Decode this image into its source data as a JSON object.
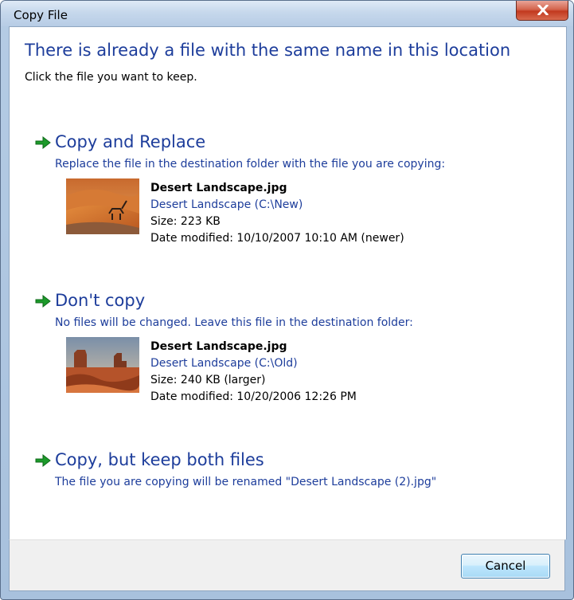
{
  "window": {
    "title": "Copy File"
  },
  "heading": "There is already a file with the same name in this location",
  "instruction": "Click the file you want to keep.",
  "options": [
    {
      "title": "Copy and Replace",
      "description": "Replace the file in the destination folder with the file you are copying:",
      "file": {
        "name": "Desert Landscape.jpg",
        "location": "Desert Landscape (C:\\New)",
        "size": "Size: 223 KB",
        "date": "Date modified: 10/10/2007 10:10 AM (newer)"
      }
    },
    {
      "title": "Don't copy",
      "description": "No files will be changed. Leave this file in the destination folder:",
      "file": {
        "name": "Desert Landscape.jpg",
        "location": "Desert Landscape (C:\\Old)",
        "size": "Size: 240 KB (larger)",
        "date": "Date modified: 10/20/2006 12:26 PM"
      }
    },
    {
      "title": "Copy, but keep both files",
      "description": "The file you are copying will be renamed \"Desert Landscape (2).jpg\""
    }
  ],
  "buttons": {
    "cancel": "Cancel"
  },
  "icons": {
    "close": "close-icon",
    "option_arrow": "green-arrow-icon"
  },
  "colors": {
    "link_blue": "#1d3d9b",
    "arrow_green": "#1c9a2a",
    "close_red": "#c2391f"
  }
}
